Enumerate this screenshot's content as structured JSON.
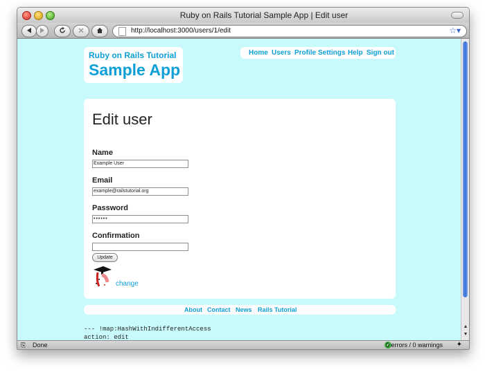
{
  "window": {
    "title": "Ruby on Rails Tutorial Sample App | Edit user"
  },
  "toolbar": {
    "url": "http://localhost:3000/users/1/edit",
    "back_icon": "back-arrow-icon",
    "forward_icon": "forward-arrow-icon",
    "reload_icon": "reload-icon",
    "stop_icon": "stop-icon",
    "home_icon": "home-icon",
    "bookmark_icon": "star-icon"
  },
  "header": {
    "logo_title": "Ruby on Rails Tutorial",
    "logo_subtitle": "Sample App",
    "nav": [
      "Home",
      "Users",
      "Profile",
      "Settings",
      "Help",
      "Sign out"
    ]
  },
  "form": {
    "heading": "Edit user",
    "name_label": "Name",
    "name_value": "Example User",
    "email_label": "Email",
    "email_value": "example@railstutorial.org",
    "password_label": "Password",
    "password_value": "••••••",
    "confirmation_label": "Confirmation",
    "confirmation_value": "",
    "update_label": "Update",
    "change_label": "change"
  },
  "footer": {
    "links": [
      "About",
      "Contact",
      "News",
      "Rails Tutorial"
    ]
  },
  "debug": {
    "line1": "--- !map:HashWithIndifferentAccess",
    "line2": "action: edit"
  },
  "statusbar": {
    "status": "Done",
    "errors": "0 errors / 0 warnings"
  },
  "colors": {
    "page_background": "#c8fafb",
    "link": "#0d9fd6"
  }
}
